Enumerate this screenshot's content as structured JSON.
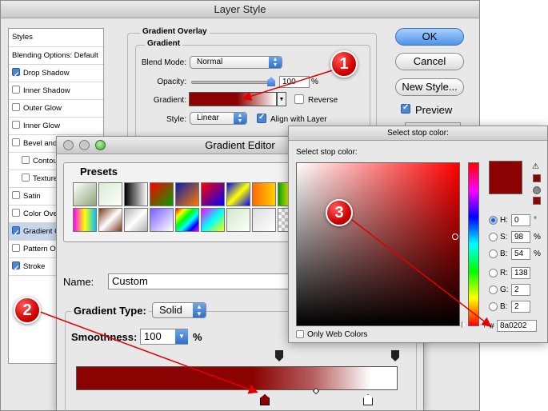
{
  "layer_style": {
    "title": "Layer Style",
    "styles_list": [
      {
        "label": "Styles",
        "checkbox": false,
        "checked": false
      },
      {
        "label": "Blending Options: Default",
        "checkbox": false,
        "checked": false
      },
      {
        "label": "Drop Shadow",
        "checkbox": true,
        "checked": true
      },
      {
        "label": "Inner Shadow",
        "checkbox": true,
        "checked": false
      },
      {
        "label": "Outer Glow",
        "checkbox": true,
        "checked": false
      },
      {
        "label": "Inner Glow",
        "checkbox": true,
        "checked": false
      },
      {
        "label": "Bevel and Emboss",
        "checkbox": true,
        "checked": false
      },
      {
        "label": "Contour",
        "checkbox": true,
        "checked": false,
        "sub": true
      },
      {
        "label": "Texture",
        "checkbox": true,
        "checked": false,
        "sub": true
      },
      {
        "label": "Satin",
        "checkbox": true,
        "checked": false
      },
      {
        "label": "Color Overlay",
        "checkbox": true,
        "checked": false
      },
      {
        "label": "Gradient Overlay",
        "checkbox": true,
        "checked": true,
        "selected": true
      },
      {
        "label": "Pattern Overlay",
        "checkbox": true,
        "checked": false
      },
      {
        "label": "Stroke",
        "checkbox": true,
        "checked": true
      }
    ],
    "group_title": "Gradient Overlay",
    "subgroup_title": "Gradient",
    "blend_mode_label": "Blend Mode:",
    "blend_mode_value": "Normal",
    "opacity_label": "Opacity:",
    "opacity_value": "100",
    "opacity_unit": "%",
    "gradient_label": "Gradient:",
    "reverse_label": "Reverse",
    "style_label": "Style:",
    "style_value": "Linear",
    "align_label": "Align with Layer",
    "buttons": {
      "ok": "OK",
      "cancel": "Cancel",
      "new_style": "New Style..."
    },
    "preview_label": "Preview"
  },
  "gradient_editor": {
    "title": "Gradient Editor",
    "presets_label": "Presets",
    "preset_swatches": [
      "linear-gradient(135deg,#fff,#8ca57a)",
      "linear-gradient(135deg,#d8ecd0,#fff)",
      "linear-gradient(90deg,#000,#fff)",
      "linear-gradient(135deg,#ff0000,#00a000)",
      "linear-gradient(135deg,#0a1fa8,#ff7a00)",
      "linear-gradient(135deg,#ff0000,#0000ff)",
      "linear-gradient(135deg,#0000ff,#ffff00,#0000ff)",
      "linear-gradient(90deg,#ff6a00,#ffd000)",
      "linear-gradient(90deg,#00a000,#ffff00,#ff0000)",
      "linear-gradient(90deg,#ff00ff,#ffff00,#00c0ff)",
      "linear-gradient(135deg,#7a3a1a,#fff,#7a3a1a)",
      "linear-gradient(135deg,#b0b0b0,#fff,#b0b0b0)",
      "linear-gradient(135deg,#7a5cff,#fff)",
      "linear-gradient(135deg,#ff0000,#ffff00,#00ff00,#00ffff,#0000ff,#ff00ff)",
      "linear-gradient(135deg,#ff00ff,#00ffff,#ffff00)",
      "linear-gradient(135deg,#cfe8c8,#fff)",
      "linear-gradient(135deg,#ddd,#fff)"
    ],
    "name_label": "Name:",
    "name_value": "Custom",
    "gradient_type_label": "Gradient Type:",
    "gradient_type_value": "Solid",
    "smoothness_label": "Smoothness:",
    "smoothness_value": "100",
    "smoothness_unit": "%"
  },
  "stop_color": {
    "title": "Select stop color:",
    "heading": "Select stop color:",
    "new_color": "#8a0202",
    "hsb": [
      {
        "label": "H:",
        "value": "0",
        "unit": "°",
        "selected": true
      },
      {
        "label": "S:",
        "value": "98",
        "unit": "%",
        "selected": false
      },
      {
        "label": "B:",
        "value": "54",
        "unit": "%",
        "selected": false
      }
    ],
    "rgb": [
      {
        "label": "R:",
        "value": "138",
        "selected": false
      },
      {
        "label": "G:",
        "value": "2",
        "selected": false
      },
      {
        "label": "B:",
        "value": "2",
        "selected": false
      }
    ],
    "hex_prefix": "#",
    "hex_value": "8a0202",
    "web_colors_label": "Only Web Colors"
  },
  "annotations": [
    "1",
    "2",
    "3"
  ],
  "colors": {
    "annotation_red": "#e10000",
    "stop_color": "#8a0202"
  }
}
